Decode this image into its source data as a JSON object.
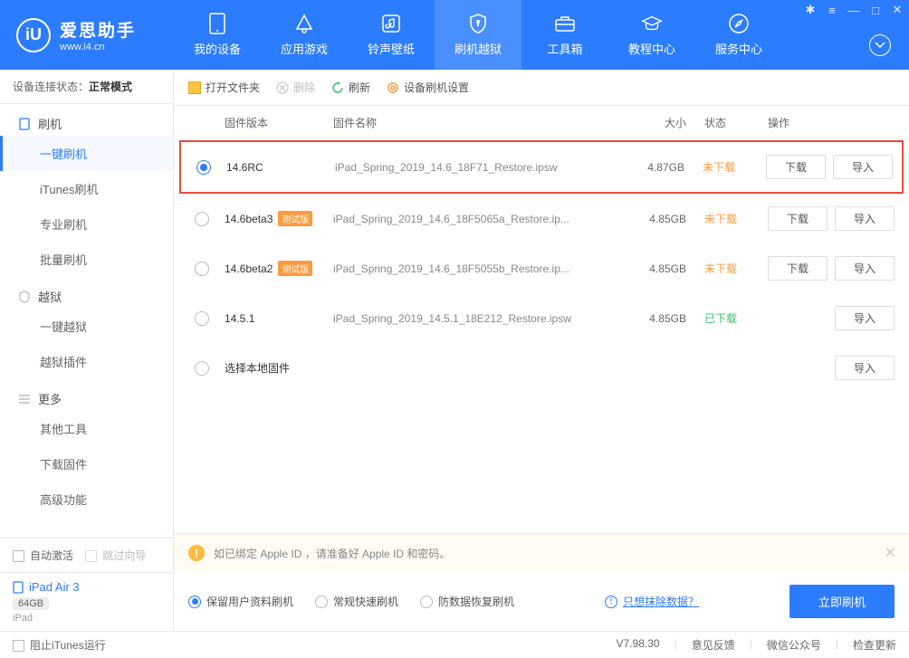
{
  "app": {
    "title": "爱思助手",
    "subtitle": "www.i4.cn"
  },
  "nav": [
    {
      "label": "我的设备"
    },
    {
      "label": "应用游戏"
    },
    {
      "label": "铃声壁纸"
    },
    {
      "label": "刷机越狱"
    },
    {
      "label": "工具箱"
    },
    {
      "label": "教程中心"
    },
    {
      "label": "服务中心"
    }
  ],
  "conn": {
    "label": "设备连接状态：",
    "status": "正常模式"
  },
  "sidebar": {
    "sec1": "刷机",
    "items1": [
      "一键刷机",
      "iTunes刷机",
      "专业刷机",
      "批量刷机"
    ],
    "sec2": "越狱",
    "items2": [
      "一键越狱",
      "越狱插件"
    ],
    "sec3": "更多",
    "items3": [
      "其他工具",
      "下载固件",
      "高级功能"
    ],
    "auto_activate": "自动激活",
    "skip_wizard": "跳过向导"
  },
  "device": {
    "name": "iPad Air 3",
    "capacity": "64GB",
    "type": "iPad"
  },
  "toolbar": {
    "open_folder": "打开文件夹",
    "delete": "删除",
    "refresh": "刷新",
    "settings": "设备刷机设置"
  },
  "table": {
    "cols": {
      "version": "固件版本",
      "name": "固件名称",
      "size": "大小",
      "status": "状态",
      "action": "操作"
    },
    "btn_download": "下载",
    "btn_import": "导入",
    "badge_test": "测试版",
    "status_no": "未下载",
    "status_yes": "已下载",
    "rows": [
      {
        "ver": "14.6RC",
        "name": "iPad_Spring_2019_14.6_18F71_Restore.ipsw",
        "size": "4.87GB",
        "downloaded": false,
        "beta": false,
        "selected": true
      },
      {
        "ver": "14.6beta3",
        "name": "iPad_Spring_2019_14.6_18F5065a_Restore.ip...",
        "size": "4.85GB",
        "downloaded": false,
        "beta": true,
        "selected": false
      },
      {
        "ver": "14.6beta2",
        "name": "iPad_Spring_2019_14.6_18F5055b_Restore.ip...",
        "size": "4.85GB",
        "downloaded": false,
        "beta": true,
        "selected": false
      },
      {
        "ver": "14.5.1",
        "name": "iPad_Spring_2019_14.5.1_18E212_Restore.ipsw",
        "size": "4.85GB",
        "downloaded": true,
        "beta": false,
        "selected": false
      }
    ],
    "local_row": "选择本地固件"
  },
  "alert": "如已绑定 Apple ID ，请准备好 Apple ID 和密码。",
  "options": {
    "o1": "保留用户资料刷机",
    "o2": "常规快速刷机",
    "o3": "防数据恢复刷机",
    "link": "只想抹除数据？",
    "flash_btn": "立即刷机"
  },
  "statusbar": {
    "block_itunes": "阻止iTunes运行",
    "version": "V7.98.30",
    "feedback": "意见反馈",
    "wechat": "微信公众号",
    "update": "检查更新"
  }
}
